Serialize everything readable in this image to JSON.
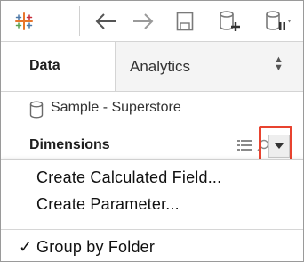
{
  "toolbar": {
    "icons": [
      "tableau-logo-icon",
      "back-arrow-icon",
      "forward-arrow-icon",
      "save-icon",
      "new-data-source-icon",
      "pause-updates-icon"
    ],
    "colors": {
      "logo_orange": "#e8762c",
      "logo_blue": "#4e79a7",
      "icon_gray": "#8a8a8a"
    }
  },
  "tabs": {
    "data_label": "Data",
    "analytics_label": "Analytics"
  },
  "data_source": {
    "name": "Sample - Superstore"
  },
  "dimensions": {
    "label": "Dimensions"
  },
  "menu": {
    "create_calculated_field": "Create Calculated Field...",
    "create_parameter": "Create Parameter...",
    "group_by_folder": "Group by Folder",
    "group_by_folder_checked": "✓"
  },
  "highlight_color": "#e8432f"
}
